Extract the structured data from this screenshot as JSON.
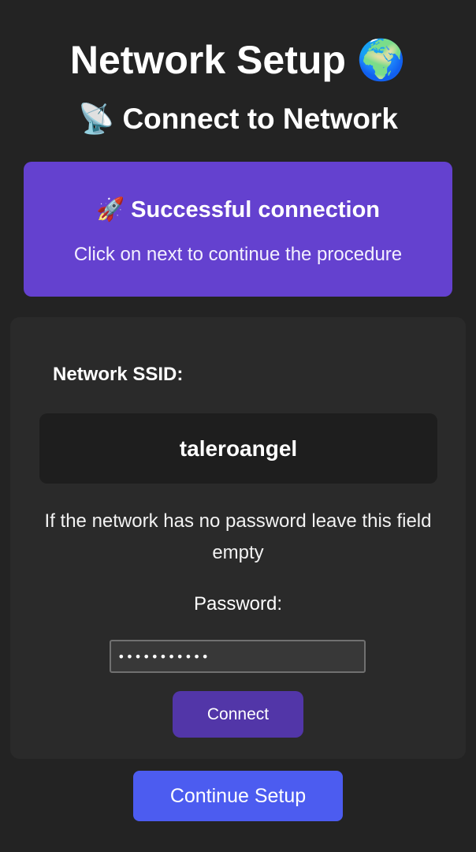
{
  "header": {
    "title": "Network Setup",
    "title_icon": "🌍",
    "subtitle": "Connect to Network",
    "subtitle_icon": "📡"
  },
  "status_banner": {
    "icon": "🚀",
    "title": "Successful connection",
    "message": "Click on next to continue the procedure",
    "color": "#6441cf"
  },
  "network_form": {
    "ssid_label": "Network SSID:",
    "ssid_value": "taleroangel",
    "hint": "If the network has no password leave this field empty",
    "password_label": "Password:",
    "password_value": "•••••••••••",
    "connect_label": "Connect",
    "connect_color": "#5236a8"
  },
  "footer": {
    "continue_label": "Continue Setup",
    "continue_color": "#4c5cf0"
  }
}
